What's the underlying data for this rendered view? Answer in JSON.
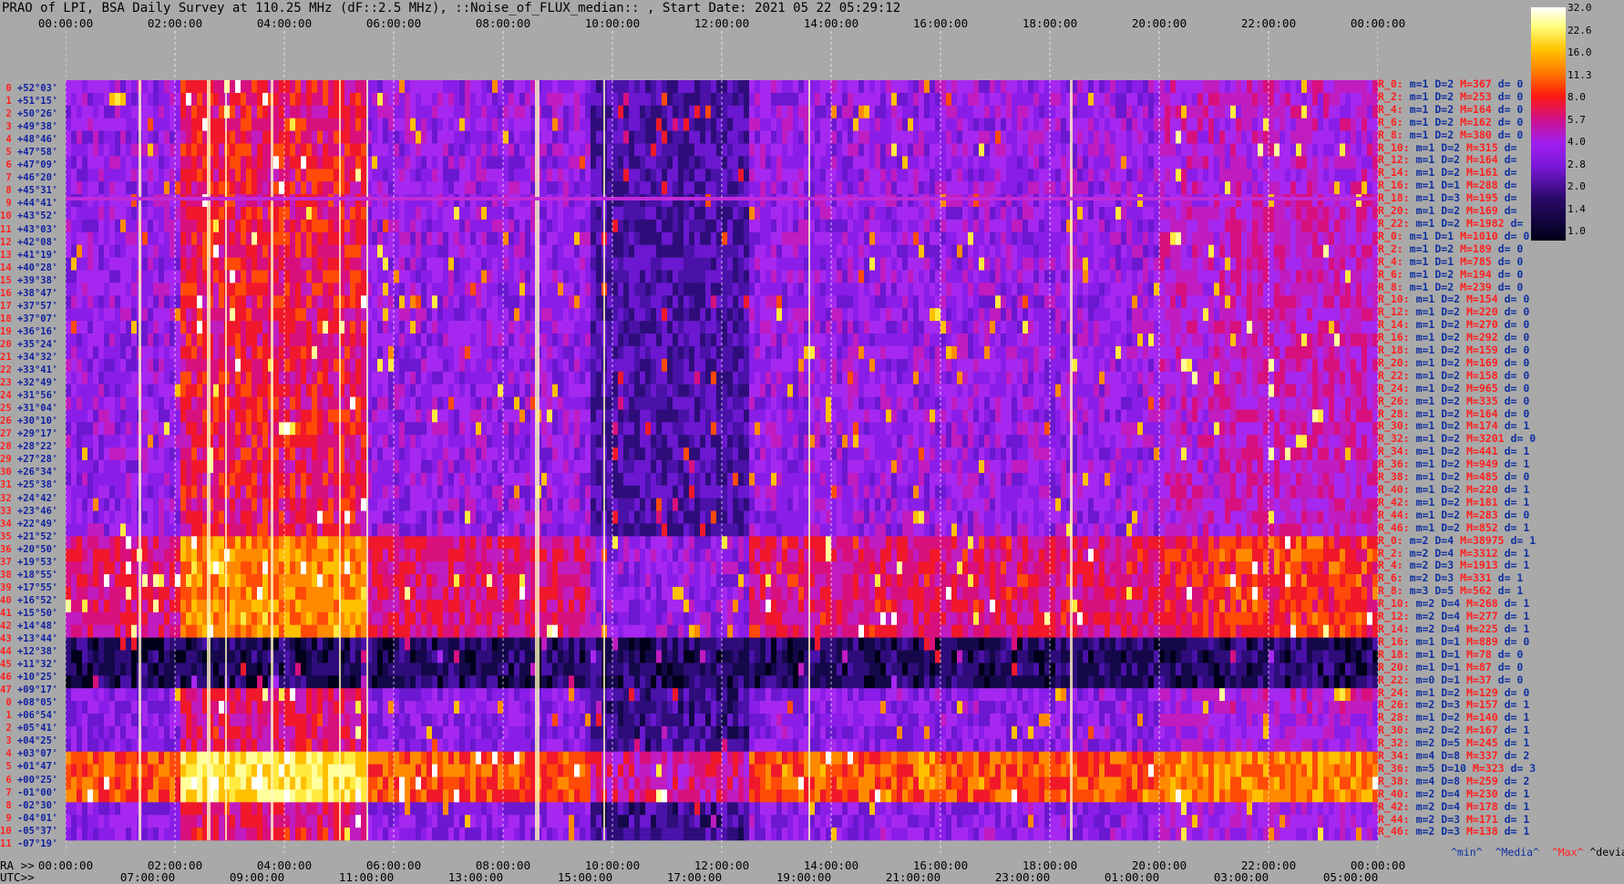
{
  "title": "PRAO of LPI, BSA Daily Survey at 110.25 MHz (dF::2.5 MHz), ::Noise_of_FLUX_median:: , Start Date: 2021 05 22 05:29:12",
  "axes": {
    "ra_prefix": "RA >>",
    "utc_prefix": "UTC>>",
    "top_ticks": [
      "00:00:00",
      "02:00:00",
      "04:00:00",
      "06:00:00",
      "08:00:00",
      "10:00:00",
      "12:00:00",
      "14:00:00",
      "16:00:00",
      "18:00:00",
      "20:00:00",
      "22:00:00",
      "00:00:00"
    ],
    "bottom_ra_ticks": [
      "00:00:00",
      "02:00:00",
      "04:00:00",
      "06:00:00",
      "08:00:00",
      "10:00:00",
      "12:00:00",
      "14:00:00",
      "16:00:00",
      "18:00:00",
      "20:00:00",
      "22:00:00",
      "00:00:00"
    ],
    "bottom_utc_ticks": [
      "07:00:00",
      "09:00:00",
      "11:00:00",
      "13:00:00",
      "15:00:00",
      "17:00:00",
      "19:00:00",
      "21:00:00",
      "23:00:00",
      "01:00:00",
      "03:00:00",
      "05:00:00"
    ]
  },
  "colorbar": {
    "ticks": [
      "32.0",
      "22.6",
      "16.0",
      "11.3",
      "8.0",
      "5.7",
      "4.0",
      "2.8",
      "2.0",
      "1.4",
      "1.0"
    ]
  },
  "legend": {
    "min": "^min^",
    "median": "^Media^",
    "max": "^Max^",
    "devia": "^devia^"
  },
  "colors": {
    "background": "#a9a9a9",
    "label_red": "#ff2020",
    "label_blue": "#1030a0"
  },
  "chart_data": {
    "type": "heatmap",
    "title": "PRAO of LPI, BSA Daily Survey at 110.25 MHz (dF::2.5 MHz), ::Noise_of_FLUX_median:: , Start Date: 2021 05 22 05:29:12",
    "x_axis": "RA 00:00:00 → 24:00:00",
    "y_axis": "Declination",
    "zlim": [
      1.0,
      32.0
    ],
    "color_scale": "log",
    "declinations": [
      "+52°03'",
      "+51°15'",
      "+50°26'",
      "+49°38'",
      "+48°46'",
      "+47°58'",
      "+47°09'",
      "+46°20'",
      "+45°31'",
      "+44°41'",
      "+43°52'",
      "+43°03'",
      "+42°08'",
      "+41°19'",
      "+40°28'",
      "+39°38'",
      "+38°47'",
      "+37°57'",
      "+37°07'",
      "+36°16'",
      "+35°24'",
      "+34°32'",
      "+33°41'",
      "+32°49'",
      "+31°56'",
      "+31°04'",
      "+30°10'",
      "+29°17'",
      "+28°22'",
      "+27°28'",
      "+26°34'",
      "+25°38'",
      "+24°42'",
      "+23°46'",
      "+22°49'",
      "+21°52'",
      "+20°50'",
      "+19°53'",
      "+18°55'",
      "+17°55'",
      "+16°52'",
      "+15°50'",
      "+14°48'",
      "+13°44'",
      "+12°38'",
      "+11°32'",
      "+10°25'",
      "+09°17'",
      "+08°05'",
      "+06°54'",
      "+05°41'",
      "+04°25'",
      "+03°07'",
      "+01°47'",
      "+00°25'",
      "-01°00'",
      "-02°30'",
      "-04°01'",
      "-05°37'",
      "-07°19'"
    ],
    "row_indices": [
      "0",
      "1",
      "2",
      "3",
      "4",
      "5",
      "6",
      "7",
      "8",
      "9",
      "10",
      "11",
      "12",
      "13",
      "14",
      "15",
      "16",
      "17",
      "18",
      "19",
      "20",
      "21",
      "22",
      "23",
      "24",
      "25",
      "26",
      "27",
      "28",
      "29",
      "30",
      "31",
      "32",
      "33",
      "34",
      "35",
      "36",
      "37",
      "38",
      "39",
      "40",
      "41",
      "42",
      "43",
      "44",
      "45",
      "46",
      "47",
      "0",
      "1",
      "2",
      "3",
      "4",
      "5",
      "6",
      "7",
      "8",
      "9",
      "10",
      "11"
    ],
    "row_stats": [
      {
        "r": "R_0:",
        "m": "m=1",
        "D": "D=2",
        "M": "M=367",
        "d": "d= 0"
      },
      {
        "r": "R_2:",
        "m": "m=1",
        "D": "D=2",
        "M": "M=253",
        "d": "d= 0"
      },
      {
        "r": "R_4:",
        "m": "m=1",
        "D": "D=2",
        "M": "M=164",
        "d": "d= 0"
      },
      {
        "r": "R_6:",
        "m": "m=1",
        "D": "D=2",
        "M": "M=162",
        "d": "d= 0"
      },
      {
        "r": "R_8:",
        "m": "m=1",
        "D": "D=2",
        "M": "M=380",
        "d": "d= 0"
      },
      {
        "r": "R_10:",
        "m": "m=1",
        "D": "D=2",
        "M": "M=315",
        "d": "d="
      },
      {
        "r": "R_12:",
        "m": "m=1",
        "D": "D=2",
        "M": "M=164",
        "d": "d="
      },
      {
        "r": "R_14:",
        "m": "m=1",
        "D": "D=2",
        "M": "M=161",
        "d": "d="
      },
      {
        "r": "R_16:",
        "m": "m=1",
        "D": "D=1",
        "M": "M=288",
        "d": "d="
      },
      {
        "r": "R_18:",
        "m": "m=1",
        "D": "D=3",
        "M": "M=195",
        "d": "d="
      },
      {
        "r": "R_20:",
        "m": "m=1",
        "D": "D=2",
        "M": "M=169",
        "d": "d="
      },
      {
        "r": "R_22:",
        "m": "m=1",
        "D": "D=2",
        "M": "M=1982",
        "d": "d="
      },
      {
        "r": "R_0:",
        "m": "m=1",
        "D": "D=1",
        "M": "M=1010",
        "d": "d= 0"
      },
      {
        "r": "R_2:",
        "m": "m=1",
        "D": "D=2",
        "M": "M=189",
        "d": "d= 0"
      },
      {
        "r": "R_4:",
        "m": "m=1",
        "D": "D=1",
        "M": "M=785",
        "d": "d= 0"
      },
      {
        "r": "R_6:",
        "m": "m=1",
        "D": "D=2",
        "M": "M=194",
        "d": "d= 0"
      },
      {
        "r": "R_8:",
        "m": "m=1",
        "D": "D=2",
        "M": "M=239",
        "d": "d= 0"
      },
      {
        "r": "R_10:",
        "m": "m=1",
        "D": "D=2",
        "M": "M=154",
        "d": "d= 0"
      },
      {
        "r": "R_12:",
        "m": "m=1",
        "D": "D=2",
        "M": "M=220",
        "d": "d= 0"
      },
      {
        "r": "R_14:",
        "m": "m=1",
        "D": "D=2",
        "M": "M=270",
        "d": "d= 0"
      },
      {
        "r": "R_16:",
        "m": "m=1",
        "D": "D=2",
        "M": "M=292",
        "d": "d= 0"
      },
      {
        "r": "R_18:",
        "m": "m=1",
        "D": "D=2",
        "M": "M=159",
        "d": "d= 0"
      },
      {
        "r": "R_20:",
        "m": "m=1",
        "D": "D=2",
        "M": "M=169",
        "d": "d= 0"
      },
      {
        "r": "R_22:",
        "m": "m=1",
        "D": "D=2",
        "M": "M=158",
        "d": "d= 0"
      },
      {
        "r": "R_24:",
        "m": "m=1",
        "D": "D=2",
        "M": "M=965",
        "d": "d= 0"
      },
      {
        "r": "R_26:",
        "m": "m=1",
        "D": "D=2",
        "M": "M=335",
        "d": "d= 0"
      },
      {
        "r": "R_28:",
        "m": "m=1",
        "D": "D=2",
        "M": "M=164",
        "d": "d= 0"
      },
      {
        "r": "R_30:",
        "m": "m=1",
        "D": "D=2",
        "M": "M=174",
        "d": "d= 1"
      },
      {
        "r": "R_32:",
        "m": "m=1",
        "D": "D=2",
        "M": "M=3201",
        "d": "d= 0"
      },
      {
        "r": "R_34:",
        "m": "m=1",
        "D": "D=2",
        "M": "M=441",
        "d": "d= 1"
      },
      {
        "r": "R_36:",
        "m": "m=1",
        "D": "D=2",
        "M": "M=949",
        "d": "d= 1"
      },
      {
        "r": "R_38:",
        "m": "m=1",
        "D": "D=2",
        "M": "M=485",
        "d": "d= 0"
      },
      {
        "r": "R_40:",
        "m": "m=1",
        "D": "D=2",
        "M": "M=220",
        "d": "d= 1"
      },
      {
        "r": "R_42:",
        "m": "m=1",
        "D": "D=2",
        "M": "M=181",
        "d": "d= 1"
      },
      {
        "r": "R_44:",
        "m": "m=1",
        "D": "D=2",
        "M": "M=283",
        "d": "d= 0"
      },
      {
        "r": "R_46:",
        "m": "m=1",
        "D": "D=2",
        "M": "M=852",
        "d": "d= 1"
      },
      {
        "r": "R_0:",
        "m": "m=2",
        "D": "D=4",
        "M": "M=38975",
        "d": "d= 1"
      },
      {
        "r": "R_2:",
        "m": "m=2",
        "D": "D=4",
        "M": "M=3312",
        "d": "d= 1"
      },
      {
        "r": "R_4:",
        "m": "m=2",
        "D": "D=3",
        "M": "M=1913",
        "d": "d= 1"
      },
      {
        "r": "R_6:",
        "m": "m=2",
        "D": "D=3",
        "M": "M=331",
        "d": "d= 1"
      },
      {
        "r": "R_8:",
        "m": "m=3",
        "D": "D=5",
        "M": "M=562",
        "d": "d= 1"
      },
      {
        "r": "R_10:",
        "m": "m=2",
        "D": "D=4",
        "M": "M=268",
        "d": "d= 1"
      },
      {
        "r": "R_12:",
        "m": "m=2",
        "D": "D=4",
        "M": "M=277",
        "d": "d= 1"
      },
      {
        "r": "R_14:",
        "m": "m=2",
        "D": "D=4",
        "M": "M=225",
        "d": "d= 1"
      },
      {
        "r": "R_16:",
        "m": "m=1",
        "D": "D=1",
        "M": "M=889",
        "d": "d= 0"
      },
      {
        "r": "R_18:",
        "m": "m=1",
        "D": "D=1",
        "M": "M=78",
        "d": "d= 0"
      },
      {
        "r": "R_20:",
        "m": "m=1",
        "D": "D=1",
        "M": "M=87",
        "d": "d= 0"
      },
      {
        "r": "R_22:",
        "m": "m=0",
        "D": "D=1",
        "M": "M=37",
        "d": "d= 0"
      },
      {
        "r": "R_24:",
        "m": "m=1",
        "D": "D=2",
        "M": "M=129",
        "d": "d= 0"
      },
      {
        "r": "R_26:",
        "m": "m=2",
        "D": "D=3",
        "M": "M=157",
        "d": "d= 1"
      },
      {
        "r": "R_28:",
        "m": "m=1",
        "D": "D=2",
        "M": "M=140",
        "d": "d= 1"
      },
      {
        "r": "R_30:",
        "m": "m=2",
        "D": "D=2",
        "M": "M=167",
        "d": "d= 1"
      },
      {
        "r": "R_32:",
        "m": "m=2",
        "D": "D=5",
        "M": "M=245",
        "d": "d= 1"
      },
      {
        "r": "R_34:",
        "m": "m=4",
        "D": "D=8",
        "M": "M=337",
        "d": "d= 2"
      },
      {
        "r": "R_36:",
        "m": "m=5",
        "D": "D=10",
        "M": "M=323",
        "d": "d= 3"
      },
      {
        "r": "R_38:",
        "m": "m=4",
        "D": "D=8",
        "M": "M=259",
        "d": "d= 2"
      },
      {
        "r": "R_40:",
        "m": "m=2",
        "D": "D=4",
        "M": "M=230",
        "d": "d= 1"
      },
      {
        "r": "R_42:",
        "m": "m=2",
        "D": "D=4",
        "M": "M=178",
        "d": "d= 1"
      },
      {
        "r": "R_44:",
        "m": "m=2",
        "D": "D=3",
        "M": "M=171",
        "d": "d= 1"
      },
      {
        "r": "R_46:",
        "m": "m=2",
        "D": "D=3",
        "M": "M=138",
        "d": "d= 1"
      }
    ]
  }
}
